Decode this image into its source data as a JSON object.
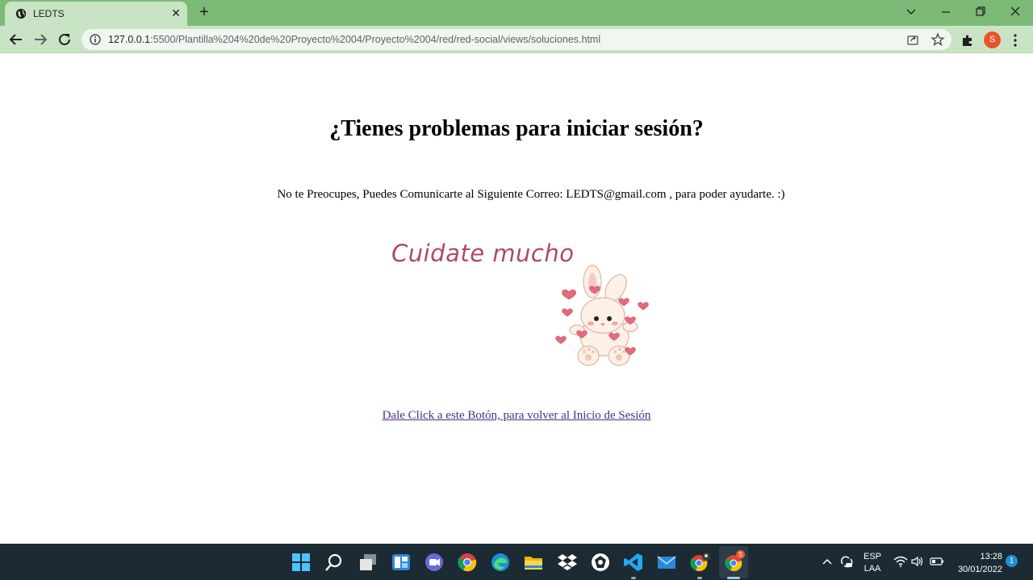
{
  "browser": {
    "tab": {
      "title": "LEDTS"
    },
    "url": {
      "host": "127.0.0.1",
      "rest": ":5500/Plantilla%204%20de%20Proyecto%2004/Proyecto%2004/red/red-social/views/soluciones.html"
    },
    "profile_initial": "S"
  },
  "page": {
    "title": "¿Tienes problemas para iniciar sesión?",
    "message": "No te Preocupes, Puedes Comunicarte al Siguiente Correo: LEDTS@gmail.com , para poder ayudarte. :)",
    "illustration_text": "Cuidate mucho",
    "back_link": "Dale Click a este Botón, para volver al Inicio de Sesión"
  },
  "taskbar": {
    "language": "ESP",
    "layout": "LAA",
    "time": "13:28",
    "date": "30/01/2022",
    "notification_count": "1",
    "chrome_badge": "S"
  },
  "colors": {
    "tabstrip": "#7dba78",
    "toolbar": "#c9e4c4",
    "taskbar": "#1b2a33",
    "link": "#4b2c8a",
    "accent_text": "#b04a63"
  }
}
